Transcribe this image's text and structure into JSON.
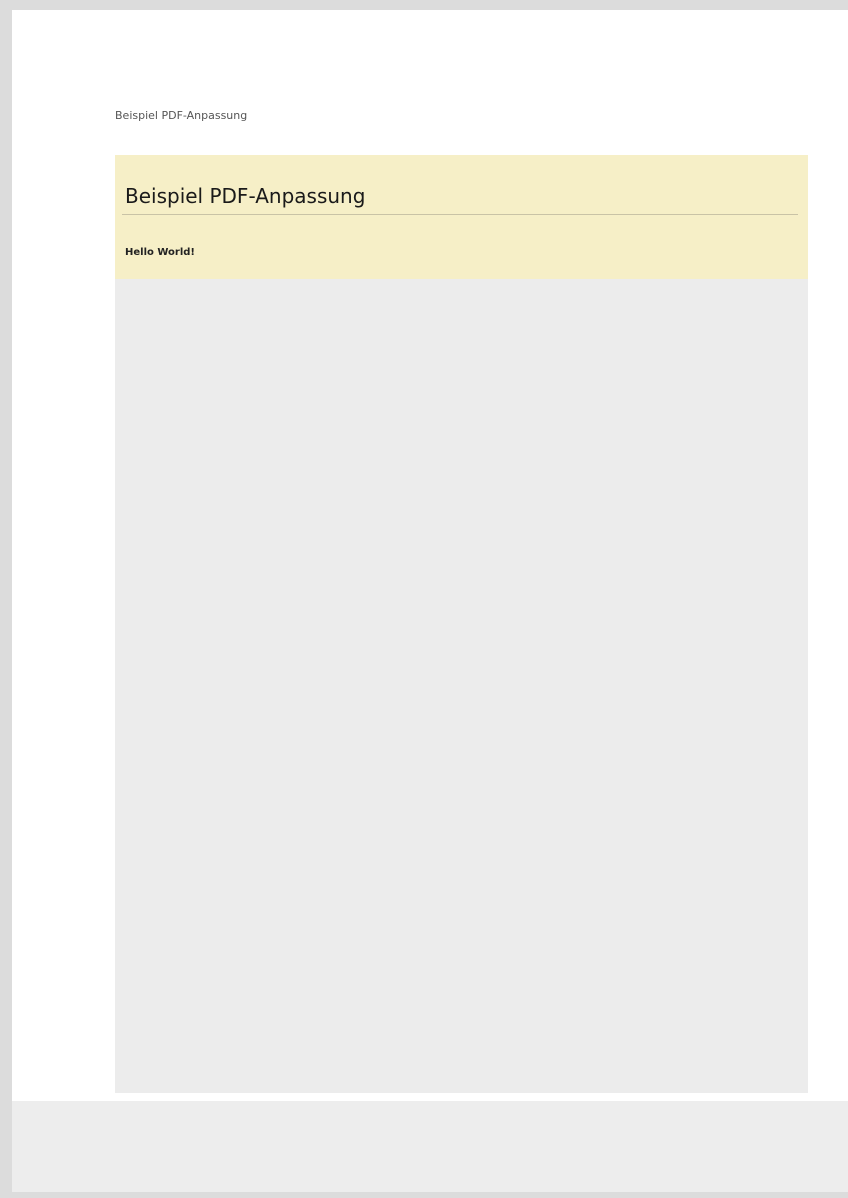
{
  "page": {
    "header_text": "Beispiel PDF-Anpassung"
  },
  "content": {
    "title": "Beispiel PDF-Anpassung",
    "body": "Hello World!"
  }
}
